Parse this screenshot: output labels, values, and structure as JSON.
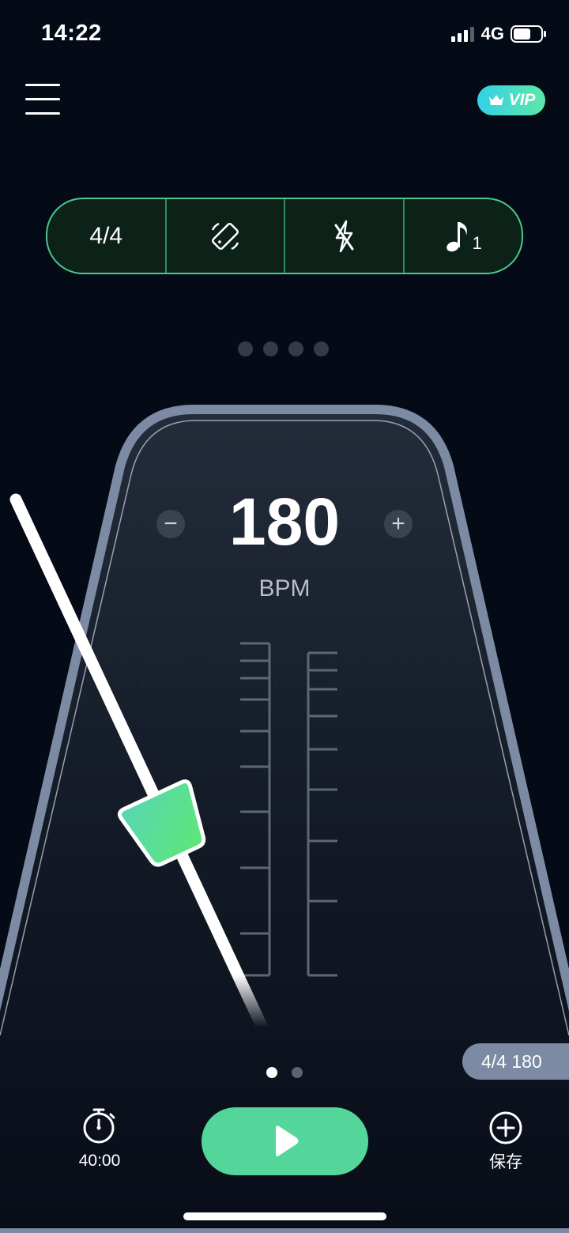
{
  "status_bar": {
    "time": "14:22",
    "network": "4G",
    "battery_level": 0.65
  },
  "header": {
    "vip_label": "VIP"
  },
  "control_bar": {
    "time_signature": "4/4",
    "accent_icon": "rotate-icon",
    "flash_icon": "flash-off-icon",
    "subdivision_icon": "music-note-icon",
    "subdivision_value": "1"
  },
  "page_indicator_top": {
    "count": 4,
    "active": -1
  },
  "metronome": {
    "bpm": "180",
    "unit": "BPM",
    "minus": "−",
    "plus": "+"
  },
  "preset": {
    "label": "4/4 180"
  },
  "page_indicator_bottom": {
    "count": 2,
    "active": 0
  },
  "footer": {
    "timer_value": "40:00",
    "save_label": "保存"
  },
  "colors": {
    "accent": "#54d69a",
    "background": "#050a17",
    "frame": "#7d8aa4",
    "control_border": "#4ac88e"
  }
}
